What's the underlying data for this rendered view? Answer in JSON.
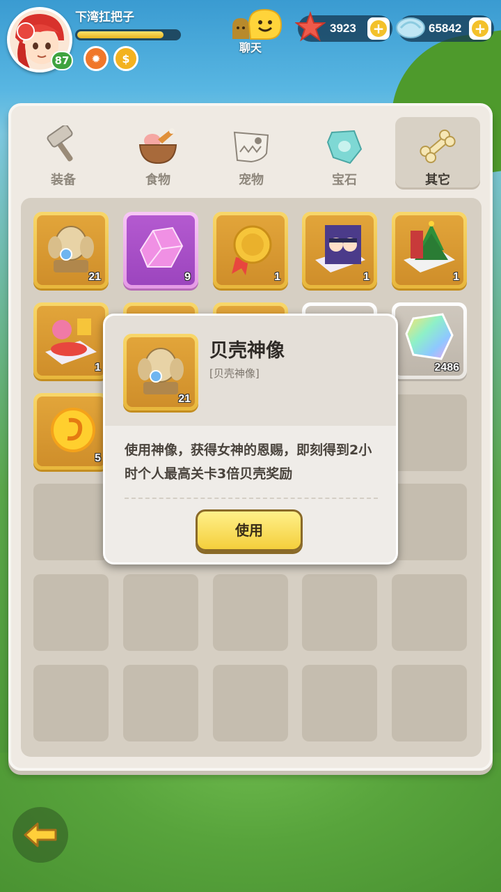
{
  "player": {
    "name": "下湾扛把子",
    "level": "87",
    "xp_fraction": 0.85
  },
  "buffs": [
    "fire-buff-icon",
    "gold-buff-icon"
  ],
  "chat": {
    "label": "聊天"
  },
  "currencies": {
    "starfish": {
      "value": "3923",
      "icon": "starfish-icon"
    },
    "shell": {
      "value": "65842",
      "icon": "shell-icon"
    }
  },
  "tabs": [
    {
      "label": "装备",
      "icon": "hammer-icon",
      "active": false
    },
    {
      "label": "食物",
      "icon": "food-bowl-icon",
      "active": false
    },
    {
      "label": "宠物",
      "icon": "dino-skull-icon",
      "active": false
    },
    {
      "label": "宝石",
      "icon": "gem-icon",
      "active": false
    },
    {
      "label": "其它",
      "icon": "bone-icon",
      "active": true
    }
  ],
  "items": [
    {
      "name": "shell-statue",
      "count": "21",
      "rarity": "gold"
    },
    {
      "name": "purple-crystal",
      "count": "9",
      "rarity": "purple"
    },
    {
      "name": "gold-medal",
      "count": "1",
      "rarity": "gold"
    },
    {
      "name": "ninja-card",
      "count": "1",
      "rarity": "gold"
    },
    {
      "name": "christmas-tree-card",
      "count": "1",
      "rarity": "gold"
    },
    {
      "name": "mermaid-card",
      "count": "1",
      "rarity": "gold"
    },
    {
      "name": "rainbow-crystal",
      "count": "2486",
      "rarity": "white"
    },
    {
      "name": "fire-orb",
      "count": "5",
      "rarity": "gold"
    }
  ],
  "popup": {
    "title": "贝壳神像",
    "subtitle": "[贝壳神像]",
    "count": "21",
    "description": "使用神像，获得女神的恩赐，即刻得到2小时个人最高关卡3倍贝壳奖励",
    "button": "使用"
  },
  "colors": {
    "gold": "#f8d76a",
    "purple": "#e59ae6",
    "button": "#f4cf3c"
  }
}
